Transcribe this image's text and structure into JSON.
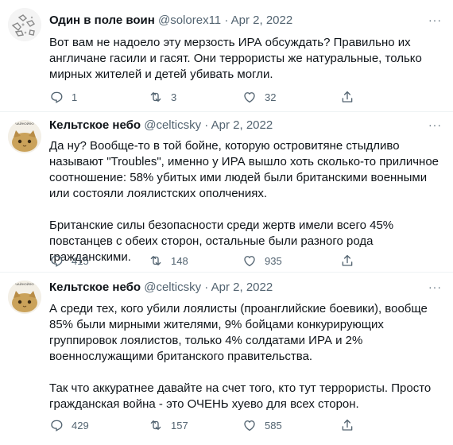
{
  "tweets": [
    {
      "name": "Один в поле воин",
      "handle": "@solorex11",
      "sep": "·",
      "date": "Apr 2, 2022",
      "more": "···",
      "paragraphs": [
        "Вот вам не надоело эту мерзость ИРА обсуждать? Правильно их англичане гасили и гасят. Они террористы же натуральные, только мирных жителей и детей убивать могли."
      ],
      "replies": "1",
      "retweets": "3",
      "likes": "32"
    },
    {
      "name": "Кельтское небо",
      "handle": "@celticsky",
      "sep": "·",
      "date": "Apr 2, 2022",
      "more": "···",
      "paragraphs": [
        "Да ну? Вообще-то в той бойне, которую островитяне стыдливо называют \"Troubles\", именно у ИРА вышло хоть сколько-то приличное соотношение: 58% убитых ими людей были британскими военными или состояли лоялистских ополчениях.",
        "Британские силы безопасности среди жертв имели всего 45% повстанцев с обеих сторон, остальные были разного рода гражданскими."
      ],
      "replies": "415",
      "retweets": "148",
      "likes": "935"
    },
    {
      "name": "Кельтское небо",
      "handle": "@celticsky",
      "sep": "·",
      "date": "Apr 2, 2022",
      "more": "···",
      "paragraphs": [
        "А среди тех, кого убили лоялисты (проанглийские боевики), вообще 85% были мирными жителями, 9% бойцами конкурирующих группировок лоялистов, только 4% солдатами ИРА и 2% военнослужащими британского правительства.",
        "Так что аккуратнее давайте на счет того, кто тут террористы. Просто гражданская война - это ОЧЕНЬ хуево для всех сторон."
      ],
      "replies": "429",
      "retweets": "157",
      "likes": "585"
    }
  ],
  "icons": {
    "reply": "reply-icon",
    "retweet": "retweet-icon",
    "like": "heart-icon",
    "share": "share-icon"
  }
}
